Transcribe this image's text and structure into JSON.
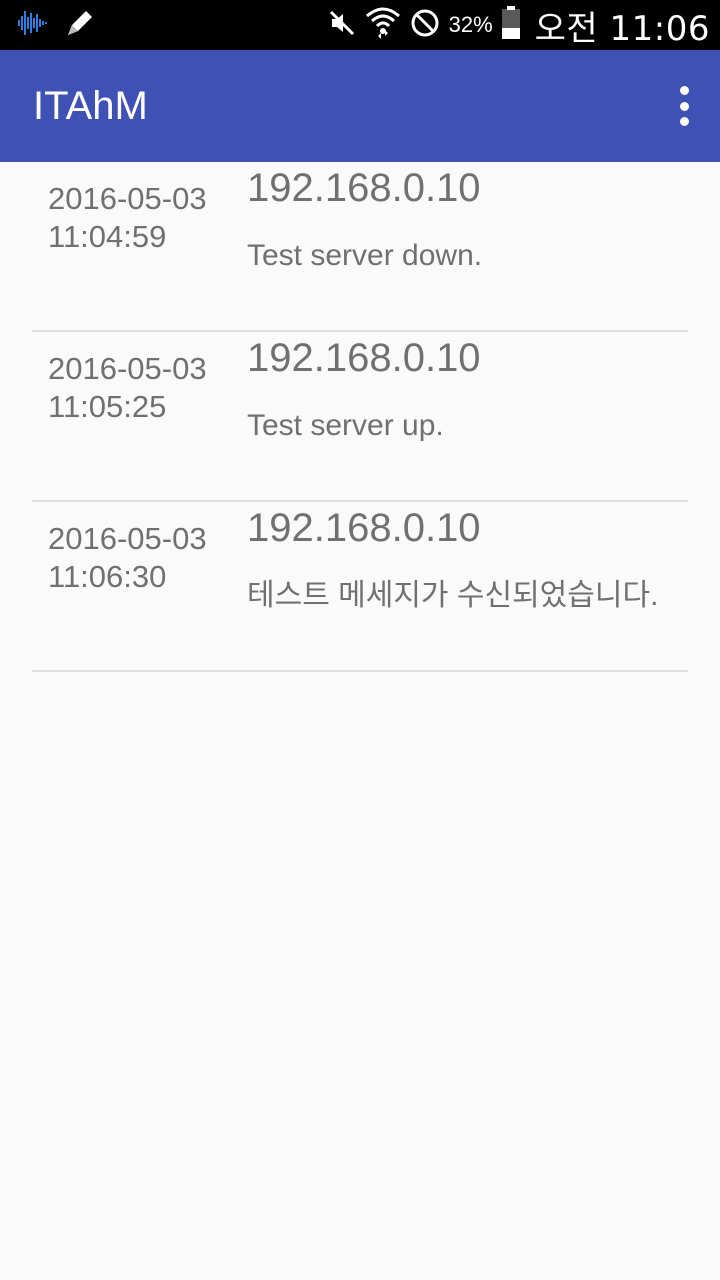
{
  "status_bar": {
    "icons_left": [
      "audio-wave-icon",
      "pencil-icon"
    ],
    "icons_right": [
      "mute-icon",
      "wifi-icon",
      "do-not-disturb-icon",
      "battery-icon"
    ],
    "battery_percent": "32%",
    "clock": "오전 11:06"
  },
  "app_bar": {
    "title": "ITAhM",
    "background": "#3f51b5",
    "menu_icon": "more-vert-icon"
  },
  "log_items": [
    {
      "date": "2016-05-03",
      "time": "11:04:59",
      "ip": "192.168.0.10",
      "message": "Test server down."
    },
    {
      "date": "2016-05-03",
      "time": "11:05:25",
      "ip": "192.168.0.10",
      "message": "Test server up."
    },
    {
      "date": "2016-05-03",
      "time": "11:06:30",
      "ip": "192.168.0.10",
      "message": "테스트 메세지가 수신되었습니다."
    }
  ]
}
